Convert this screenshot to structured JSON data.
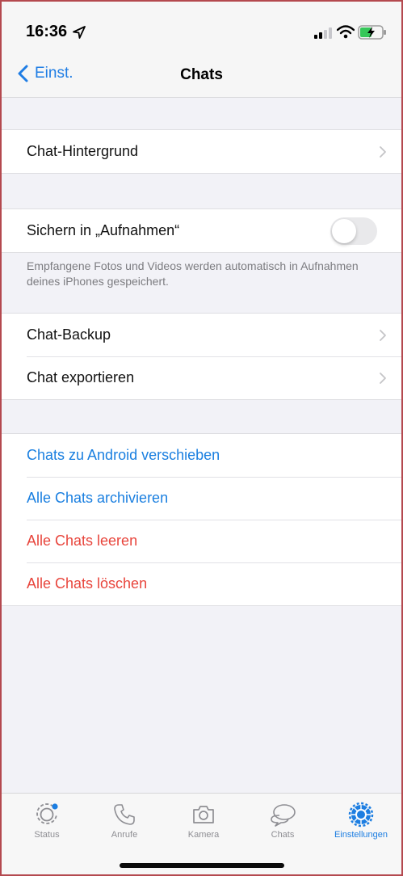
{
  "status_bar": {
    "time": "16:36",
    "icons": [
      "location-arrow-icon",
      "signal-icon",
      "wifi-icon",
      "battery-charging-icon"
    ]
  },
  "nav": {
    "back_label": "Einst.",
    "title": "Chats"
  },
  "sections": {
    "wallpaper": {
      "label": "Chat-Hintergrund"
    },
    "save_to_photos": {
      "label": "Sichern in „Aufnahmen“",
      "toggle_on": false,
      "footnote": "Empfangene Fotos und Videos werden automatisch in Aufnahmen deines iPhones gespeichert."
    },
    "backup": {
      "items": [
        "Chat-Backup",
        "Chat exportieren"
      ]
    },
    "actions": {
      "items": [
        {
          "label": "Chats zu Android verschieben",
          "color": "#1a7fe0"
        },
        {
          "label": "Alle Chats archivieren",
          "color": "#1a7fe0"
        },
        {
          "label": "Alle Chats leeren",
          "color": "#e8453c"
        },
        {
          "label": "Alle Chats löschen",
          "color": "#e8453c"
        }
      ]
    }
  },
  "tab_bar": {
    "active_color": "#1d7ee1",
    "tabs": [
      {
        "label": "Status",
        "icon": "status-icon"
      },
      {
        "label": "Anrufe",
        "icon": "phone-icon"
      },
      {
        "label": "Kamera",
        "icon": "camera-icon"
      },
      {
        "label": "Chats",
        "icon": "chat-bubbles-icon"
      },
      {
        "label": "Einstellungen",
        "icon": "settings-gear-icon",
        "active": true
      }
    ]
  }
}
